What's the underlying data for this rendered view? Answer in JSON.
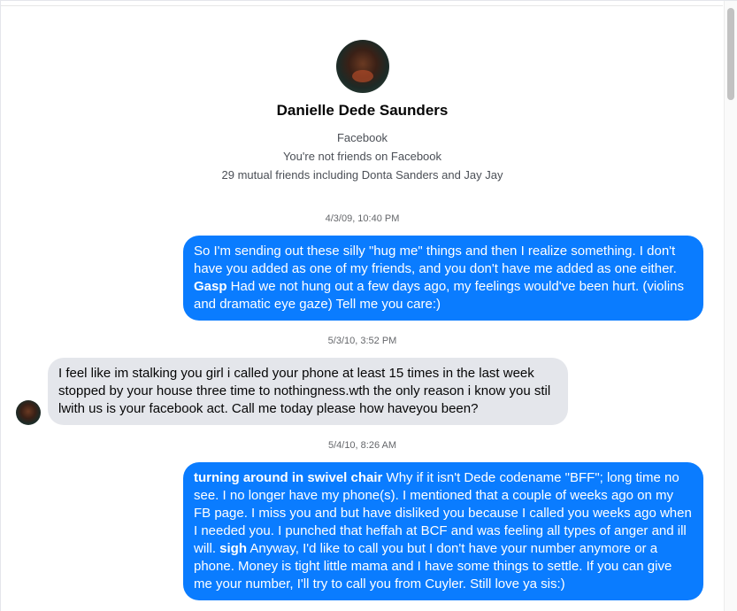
{
  "profile": {
    "name": "Danielle Dede Saunders",
    "platform": "Facebook",
    "friend_status": "You're not friends on Facebook",
    "mutual": "29 mutual friends including Donta Sanders and Jay Jay"
  },
  "colors": {
    "outgoing_bubble": "#0a7cff",
    "incoming_bubble": "#e4e6eb"
  },
  "messages": [
    {
      "timestamp": "4/3/09, 10:40 PM",
      "direction": "outgoing",
      "segments": [
        "So I'm sending out these silly \"hug me\" things and then I realize something. I don't have you added as one of my friends, and you don't have me added as one either. ",
        "Gasp",
        " Had we not hung out a few days ago, my feelings would've been hurt. (violins and dramatic eye gaze) Tell me you care:)"
      ]
    },
    {
      "timestamp": "5/3/10, 3:52 PM",
      "direction": "incoming",
      "segments": [
        "I feel like im stalking you girl i called your phone at least 15 times in the last week stopped by your house three time to nothingness.wth the only reason i know you stil lwith us is your facebook act. Call me today please how haveyou been?"
      ]
    },
    {
      "timestamp": "5/4/10, 8:26 AM",
      "direction": "outgoing",
      "segments": [
        "turning around in swivel chair",
        " Why if it isn't Dede codename \"BFF\"; long time no see. I no longer have my phone(s). I mentioned that a couple of weeks ago on my FB page. I miss you and but have disliked you because I called you weeks ago when I needed you. I punched that heffah at BCF and was feeling all types of anger and ill will. ",
        "sigh",
        " Anyway, I'd like to call you but I don't have your number anymore or a phone. Money is tight little mama and I have some things to settle.  If you can give me your number, I'll try to call you from Cuyler.  Still love ya sis:)"
      ]
    }
  ]
}
